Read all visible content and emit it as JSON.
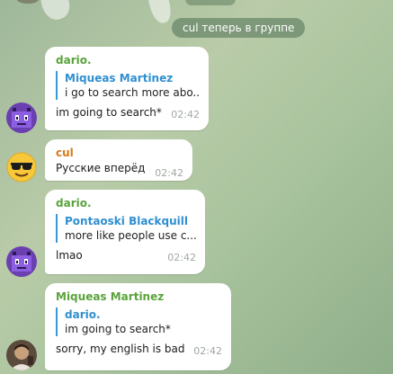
{
  "service_message": "cul теперь в группе",
  "messages": [
    {
      "sender": "dario.",
      "sender_color": "#59a33a",
      "reply": {
        "name": "Miqueas Martinez",
        "text": "i go to search more abo..."
      },
      "text": "im going to search*",
      "time": "02:42",
      "avatar": "purple-pixel-avatar"
    },
    {
      "sender": "cul",
      "sender_color": "#d67a1a",
      "text": "Русские вперёд",
      "time": "02:42",
      "avatar": "sunglasses-emoji-avatar"
    },
    {
      "sender": "dario.",
      "sender_color": "#59a33a",
      "reply": {
        "name": "Pontaoski Blackquill",
        "text": "more like people use c..."
      },
      "text": "lmao",
      "time": "02:42",
      "avatar": "purple-pixel-avatar"
    },
    {
      "sender": "Miqueas Martinez",
      "sender_color": "#59a33a",
      "reply": {
        "name": "dario.",
        "text": "im going to search*"
      },
      "text": "sorry, my english is bad",
      "time": "02:42",
      "avatar": "photo-avatar"
    }
  ],
  "colors": {
    "reply_accent": "#3b98d6",
    "time_text": "#a0a8a0",
    "service_bg": "#4e7054"
  }
}
